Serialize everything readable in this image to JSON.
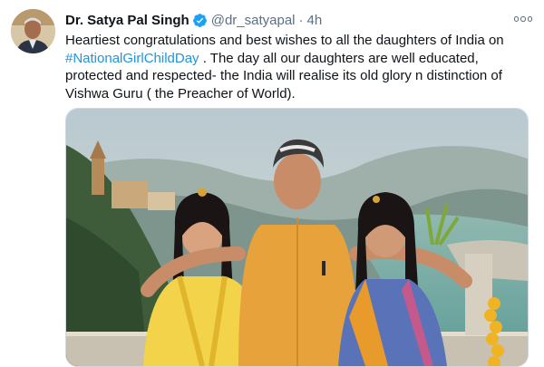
{
  "tweet": {
    "author_name": "Dr. Satya Pal Singh",
    "handle": "@dr_satyapal",
    "separator": "·",
    "time": "4h",
    "text_part1": "Heartiest congratulations and best wishes to all the daughters of India on ",
    "hashtag": "#NationalGirlChildDay",
    "text_part2": " . The day all our daughters are well educated, protected and respected- the India will realise its old glory n distinction of Vishwa Guru ( the Preacher of World)."
  },
  "icons": {
    "verified": "verified-badge-icon",
    "more": "more-options-icon"
  },
  "colors": {
    "link": "#1b95e0",
    "verified": "#1da1f2",
    "secondary_text": "#5b7083"
  }
}
